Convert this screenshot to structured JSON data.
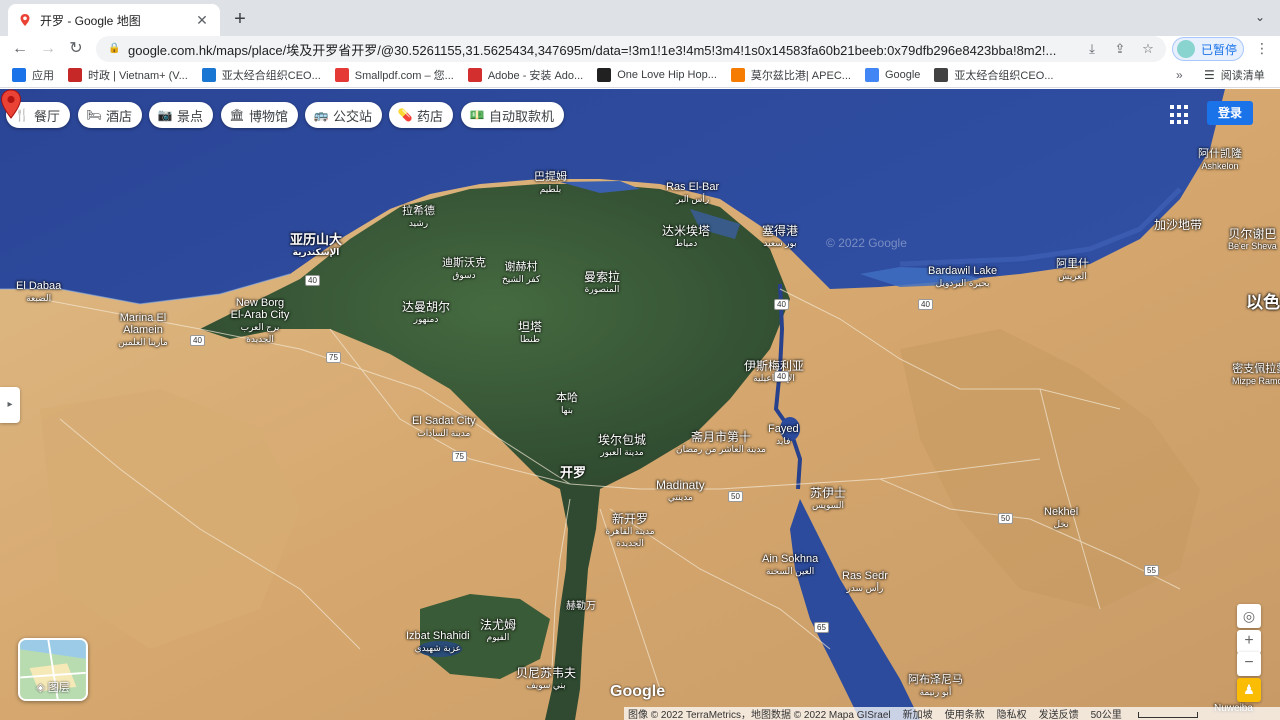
{
  "browser": {
    "tab_title": "开罗 - Google 地图",
    "url_host": "google.com.hk",
    "url_path": "/maps/place/埃及开罗省开罗/@30.5261155,31.5625434,347695m/data=!3m1!1e3!4m5!3m4!1s0x14583fa60b21beeb:0x79dfb296e8423bba!8m2!...",
    "profile_label": "已暂停",
    "bookmarks": [
      {
        "label": "应用",
        "color": "#1a73e8"
      },
      {
        "label": "时政 | Vietnam+ (V...",
        "color": "#c62828"
      },
      {
        "label": "亚太经合组织CEO...",
        "color": "#1976d2"
      },
      {
        "label": "Smallpdf.com – 您...",
        "color": "#e53935"
      },
      {
        "label": "Adobe - 安装 Ado...",
        "color": "#d32f2f"
      },
      {
        "label": "One Love Hip Hop...",
        "color": "#212121"
      },
      {
        "label": "莫尔兹比港| APEC...",
        "color": "#f57c00"
      },
      {
        "label": "Google",
        "color": "#4285f4"
      },
      {
        "label": "亚太经合组织CEO...",
        "color": "#424242"
      }
    ],
    "bookmarks_more": "»",
    "reading_list": "阅读清单"
  },
  "map": {
    "chips": [
      {
        "label": "餐厅",
        "icon": "🍴",
        "name": "restaurants"
      },
      {
        "label": "酒店",
        "icon": "🛏",
        "name": "hotels"
      },
      {
        "label": "景点",
        "icon": "📷",
        "name": "attractions"
      },
      {
        "label": "博物馆",
        "icon": "🏛",
        "name": "museums"
      },
      {
        "label": "公交站",
        "icon": "🚌",
        "name": "transit"
      },
      {
        "label": "药店",
        "icon": "💊",
        "name": "pharmacies"
      },
      {
        "label": "自动取款机",
        "icon": "💵",
        "name": "atms"
      }
    ],
    "signin_label": "登录",
    "layers_label": "图层",
    "google_logo": "Google",
    "zoom_in": "+",
    "zoom_out": "−",
    "places": {
      "baltim": {
        "name": "巴提姆",
        "ar": "بلطيم"
      },
      "ras_el_bar": {
        "name": "Ras El-Bar",
        "ar": "رأس البر"
      },
      "rashid": {
        "name": "拉希德",
        "ar": "رشيد"
      },
      "alexandria": {
        "name": "亚历山大",
        "ar": "الإسكندرية"
      },
      "damietta": {
        "name": "达米埃塔",
        "ar": "دمياط"
      },
      "port_said": {
        "name": "塞得港",
        "ar": "بور سعيد"
      },
      "desouk": {
        "name": "迪斯沃克",
        "ar": "دسوق"
      },
      "sherbin": {
        "name": "谢赫村",
        "ar": "كفر الشيخ"
      },
      "mansoura": {
        "name": "曼索拉",
        "ar": "المنصورة"
      },
      "el_dabaa": {
        "name": "El Dabaa",
        "ar": "الضبعة"
      },
      "new_borg": {
        "name": "New Borg El-Arab City",
        "ar": "برج العرب الجديدة"
      },
      "marina": {
        "name": "Marina El Alamein",
        "ar": "مارينا العلمين"
      },
      "damanhur": {
        "name": "达曼胡尔",
        "ar": "دمنهور"
      },
      "tanta": {
        "name": "坦塔",
        "ar": "طنطا"
      },
      "ismailia": {
        "name": "伊斯梅利亚",
        "ar": "الإسماعيلية"
      },
      "bardawil": {
        "name": "Bardawil Lake",
        "ar": "بحيرة البردويل"
      },
      "arish": {
        "name": "阿里什",
        "ar": "العريش"
      },
      "gaza": {
        "name": "加沙地带"
      },
      "ashkelon": {
        "name": "阿什凯隆",
        "en": "Ashkelon"
      },
      "beer_sheva": {
        "name": "贝尔谢巴",
        "en": "Be'er Sheva"
      },
      "israel": {
        "name": "以色列"
      },
      "mitzpe": {
        "name": "密支佩拉蒙",
        "en": "Mizpe Ramon"
      },
      "benha": {
        "name": "本哈",
        "ar": "بنها"
      },
      "sadat": {
        "name": "El Sadat City",
        "ar": "مدينة السادات"
      },
      "obour": {
        "name": "埃尔包城",
        "ar": "مدينة العبور"
      },
      "tenth": {
        "name": "斋月市第十",
        "ar": "مدينة العاشر من رمضان"
      },
      "fayed": {
        "name": "Fayed",
        "ar": "فايد"
      },
      "cairo": {
        "name": "开罗",
        "ar": "القاهرة"
      },
      "madinaty": {
        "name": "Madinaty",
        "ar": "مدينتي"
      },
      "suez": {
        "name": "苏伊士",
        "ar": "السويس"
      },
      "new_cairo": {
        "name": "新开罗",
        "ar": "مدينة القاهرة الجديدة"
      },
      "nekhel": {
        "name": "Nekhel",
        "ar": "نخل"
      },
      "ain_sokhna": {
        "name": "Ain Sokhna",
        "ar": "العين السخنة"
      },
      "ras_sedr": {
        "name": "Ras Sedr",
        "ar": "رأس سدر"
      },
      "faiyum": {
        "name": "法尤姆",
        "ar": "الفيوم"
      },
      "izbat": {
        "name": "Izbat Shahidi",
        "ar": "عزبة شهيدي"
      },
      "beni_suef": {
        "name": "贝尼苏韦夫",
        "ar": "بني سويف"
      },
      "abu_zenima": {
        "name": "阿布泽尼马",
        "ar": "أبو زنيمة"
      },
      "nuweiba": {
        "name": "Nuweiba"
      },
      "helwan": {
        "name": "赫勒万"
      }
    },
    "roads": [
      "40",
      "40",
      "75",
      "40",
      "40",
      "75",
      "50",
      "50",
      "55",
      "65",
      "40"
    ],
    "watermark": "© 2022 Google",
    "footer": {
      "imagery": "图像 © 2022 TerraMetrics，地图数据 © 2022 Mapa GISrael",
      "country": "新加坡",
      "terms": "使用条款",
      "privacy": "隐私权",
      "feedback": "发送反馈",
      "scale": "50公里"
    },
    "colors": {
      "sea": "#2d4aa0",
      "desert": "#d9b07a",
      "delta": "#3c5a3a",
      "pin": "#ea4335",
      "accent": "#1a73e8"
    }
  }
}
